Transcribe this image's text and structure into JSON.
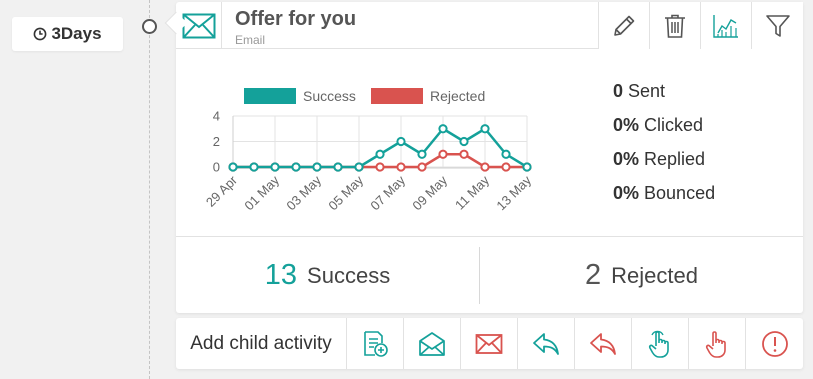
{
  "delay": {
    "label": "3Days",
    "icon": "clock-icon"
  },
  "card": {
    "title": "Offer for you",
    "subtitle": "Email",
    "icon": "envelope-icon",
    "actions": [
      "edit-icon",
      "trash-icon",
      "chart-icon",
      "filter-icon"
    ]
  },
  "stats": {
    "sent": {
      "value": "0",
      "label": "Sent"
    },
    "clicked": {
      "value": "0%",
      "label": "Clicked"
    },
    "replied": {
      "value": "0%",
      "label": "Replied"
    },
    "bounced": {
      "value": "0%",
      "label": "Bounced"
    }
  },
  "totals": {
    "success": {
      "value": "13",
      "label": "Success"
    },
    "rejected": {
      "value": "2",
      "label": "Rejected"
    }
  },
  "bottom": {
    "add_child_label": "Add child activity",
    "actions": [
      "add-note-icon",
      "open-envelope-icon",
      "envelope-icon",
      "reply-icon",
      "reply-icon",
      "pointer-hand-icon",
      "hand-icon",
      "alert-circle-icon"
    ]
  },
  "colors": {
    "accent": "#14a19a",
    "reject": "#d9534f"
  },
  "chart_data": {
    "type": "line",
    "x": [
      "29 Apr",
      "30 Apr",
      "01 May",
      "02 May",
      "03 May",
      "04 May",
      "05 May",
      "06 May",
      "07 May",
      "08 May",
      "09 May",
      "10 May",
      "11 May",
      "12 May",
      "13 May"
    ],
    "xticks": [
      "29 Apr",
      "01 May",
      "03 May",
      "05 May",
      "07 May",
      "09 May",
      "11 May",
      "13 May"
    ],
    "series": [
      {
        "name": "Success",
        "color": "#14a19a",
        "values": [
          0,
          0,
          0,
          0,
          0,
          0,
          0,
          1,
          2,
          1,
          3,
          2,
          3,
          1,
          0
        ]
      },
      {
        "name": "Rejected",
        "color": "#d9534f",
        "values": [
          0,
          0,
          0,
          0,
          0,
          0,
          0,
          0,
          0,
          0,
          1,
          1,
          0,
          0,
          0
        ]
      }
    ],
    "yticks": [
      0,
      2,
      4
    ],
    "ylim": [
      0,
      4
    ],
    "legend": "top"
  }
}
